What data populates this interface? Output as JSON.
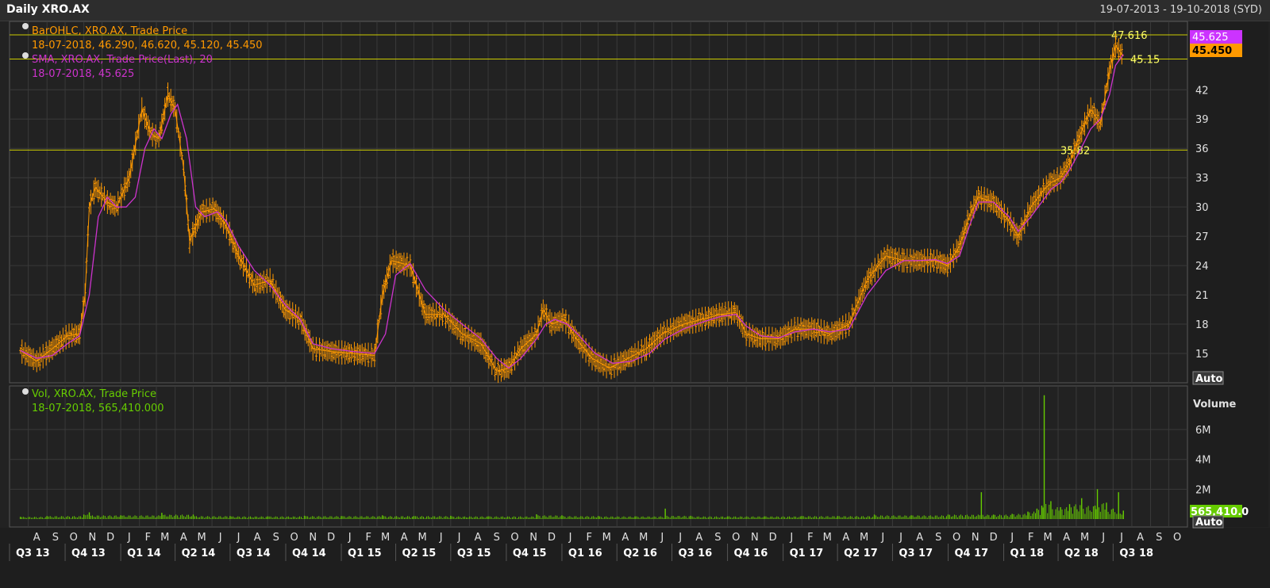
{
  "header": {
    "title": "Daily XRO.AX",
    "date_range": "19-07-2013 - 19-10-2018 (SYD)"
  },
  "colors": {
    "price": "#ff9900",
    "sma": "#cc33cc",
    "volume": "#66cc00",
    "hline": "#cccc00",
    "grid": "#3a3a3a",
    "axis_text": "#e0e0e0"
  },
  "price_panel": {
    "legend_ohlc_label": "BarOHLC, XRO.AX, Trade Price",
    "legend_ohlc_values": "18-07-2018, 46.290, 46.620, 45.120, 45.450",
    "legend_sma_label": "SMA, XRO.AX, Trade Price(Last),  20",
    "legend_sma_values": "18-07-2018, 45.625",
    "last_sma_badge": "45.625",
    "last_price_badge": "45.450",
    "auto_label": "Auto"
  },
  "volume_panel": {
    "legend_label": "Vol, XRO.AX, Trade Price",
    "legend_values": "18-07-2018, 565,410.000",
    "axis_title": "Volume",
    "last_volume_badge": "565,410.0",
    "auto_label": "Auto"
  },
  "chart_data": [
    {
      "type": "line",
      "subtype": "ohlc",
      "y_ticks": [
        15,
        18,
        21,
        24,
        27,
        30,
        33,
        36,
        39,
        42
      ],
      "ylim": [
        12,
        49
      ],
      "horizontal_lines": [
        {
          "value": 47.616,
          "label": "47.616"
        },
        {
          "value": 45.15,
          "label": "45.15"
        },
        {
          "value": 35.82,
          "label": "35.82"
        }
      ],
      "series": [
        {
          "name": "BarOHLC, XRO.AX, Trade Price",
          "x": [
            "2013-07-19",
            "2013-08-15",
            "2013-09-10",
            "2013-10-05",
            "2013-10-25",
            "2013-11-03",
            "2013-11-10",
            "2013-11-20",
            "2013-12-10",
            "2013-12-25",
            "2014-01-15",
            "2014-02-05",
            "2014-02-20",
            "2014-03-05",
            "2014-03-20",
            "2014-04-01",
            "2014-04-15",
            "2014-04-25",
            "2014-05-15",
            "2014-06-05",
            "2014-06-25",
            "2014-07-15",
            "2014-08-10",
            "2014-09-05",
            "2014-09-30",
            "2014-10-25",
            "2014-11-15",
            "2014-12-15",
            "2015-01-20",
            "2015-02-25",
            "2015-03-10",
            "2015-03-25",
            "2015-04-25",
            "2015-05-20",
            "2015-06-20",
            "2015-07-20",
            "2015-08-20",
            "2015-09-15",
            "2015-10-05",
            "2015-10-25",
            "2015-11-20",
            "2015-12-01",
            "2015-12-15",
            "2016-01-05",
            "2016-01-25",
            "2016-02-20",
            "2016-03-20",
            "2016-04-20",
            "2016-05-20",
            "2016-06-15",
            "2016-07-20",
            "2016-08-20",
            "2016-09-20",
            "2016-10-15",
            "2016-11-01",
            "2016-11-25",
            "2016-12-25",
            "2017-01-20",
            "2017-02-20",
            "2017-03-20",
            "2017-04-20",
            "2017-05-20",
            "2017-06-20",
            "2017-07-20",
            "2017-08-10",
            "2017-09-10",
            "2017-09-30",
            "2017-10-20",
            "2017-11-05",
            "2017-11-20",
            "2017-12-15",
            "2018-01-10",
            "2018-01-25",
            "2018-02-15",
            "2018-03-05",
            "2018-03-20",
            "2018-04-05",
            "2018-04-20",
            "2018-05-05",
            "2018-05-25",
            "2018-06-10",
            "2018-06-25",
            "2018-07-05",
            "2018-07-18"
          ],
          "values": [
            15.3,
            14.2,
            15.5,
            16.8,
            17.0,
            21.0,
            30.0,
            32.0,
            30.5,
            30.0,
            33.0,
            40.0,
            37.5,
            37.0,
            41.5,
            40.0,
            34.0,
            26.5,
            29.5,
            29.8,
            28.0,
            25.0,
            22.0,
            22.5,
            19.5,
            18.5,
            15.5,
            15.2,
            15.0,
            14.8,
            21.0,
            24.5,
            24.0,
            19.0,
            19.0,
            17.0,
            16.0,
            13.2,
            13.5,
            15.5,
            17.0,
            19.5,
            18.0,
            18.5,
            16.5,
            14.5,
            13.5,
            14.5,
            15.5,
            17.0,
            18.0,
            18.5,
            19.0,
            19.2,
            17.0,
            16.5,
            16.5,
            17.5,
            17.5,
            17.0,
            18.0,
            22.5,
            25.0,
            24.5,
            24.5,
            24.5,
            24.0,
            26.0,
            29.0,
            31.0,
            30.5,
            28.5,
            27.0,
            30.0,
            31.5,
            32.5,
            33.0,
            34.5,
            37.0,
            40.0,
            38.5,
            44.0,
            46.5,
            45.45
          ]
        },
        {
          "name": "SMA, XRO.AX, Trade Price(Last),  20",
          "x": [
            "2013-07-19",
            "2013-08-15",
            "2013-09-10",
            "2013-10-05",
            "2013-10-25",
            "2013-11-10",
            "2013-11-25",
            "2013-12-10",
            "2013-12-25",
            "2014-01-10",
            "2014-01-25",
            "2014-02-10",
            "2014-02-25",
            "2014-03-10",
            "2014-03-25",
            "2014-04-05",
            "2014-04-20",
            "2014-05-05",
            "2014-05-20",
            "2014-06-10",
            "2014-06-25",
            "2014-07-15",
            "2014-08-10",
            "2014-09-05",
            "2014-09-30",
            "2014-10-25",
            "2014-11-15",
            "2014-12-15",
            "2015-01-20",
            "2015-02-25",
            "2015-03-15",
            "2015-04-01",
            "2015-04-25",
            "2015-05-20",
            "2015-06-20",
            "2015-07-20",
            "2015-08-20",
            "2015-09-15",
            "2015-10-05",
            "2015-10-25",
            "2015-11-20",
            "2015-12-05",
            "2015-12-20",
            "2016-01-10",
            "2016-01-30",
            "2016-02-25",
            "2016-03-25",
            "2016-04-25",
            "2016-05-25",
            "2016-06-20",
            "2016-07-20",
            "2016-08-20",
            "2016-09-20",
            "2016-10-15",
            "2016-11-01",
            "2016-11-25",
            "2016-12-25",
            "2017-01-20",
            "2017-02-20",
            "2017-03-20",
            "2017-04-20",
            "2017-05-20",
            "2017-06-20",
            "2017-07-20",
            "2017-08-10",
            "2017-09-10",
            "2017-09-30",
            "2017-10-20",
            "2017-11-05",
            "2017-11-20",
            "2017-12-15",
            "2018-01-10",
            "2018-01-25",
            "2018-02-15",
            "2018-03-05",
            "2018-03-20",
            "2018-04-05",
            "2018-04-20",
            "2018-05-05",
            "2018-05-25",
            "2018-06-10",
            "2018-06-25",
            "2018-07-05",
            "2018-07-18"
          ],
          "values": [
            15.3,
            14.5,
            14.8,
            16.0,
            16.8,
            21.0,
            29.0,
            31.0,
            30.0,
            30.0,
            31.0,
            36.0,
            38.0,
            37.0,
            39.5,
            40.5,
            37.0,
            30.0,
            29.0,
            29.5,
            28.5,
            26.0,
            23.5,
            22.0,
            20.0,
            18.5,
            16.0,
            15.5,
            15.2,
            15.0,
            17.0,
            23.0,
            24.2,
            21.5,
            19.5,
            18.0,
            16.5,
            14.5,
            13.5,
            14.5,
            16.5,
            18.0,
            18.5,
            18.0,
            16.8,
            15.0,
            14.0,
            14.2,
            15.0,
            16.5,
            17.5,
            18.2,
            18.8,
            19.0,
            17.8,
            16.8,
            16.6,
            17.2,
            17.5,
            17.2,
            17.5,
            21.0,
            23.5,
            24.5,
            24.5,
            24.6,
            24.2,
            25.0,
            28.0,
            30.5,
            30.5,
            29.0,
            27.5,
            29.0,
            30.5,
            31.8,
            32.5,
            33.8,
            35.5,
            38.0,
            39.0,
            41.5,
            44.5,
            45.625
          ]
        }
      ]
    },
    {
      "type": "bar",
      "title": "Volume",
      "y_ticks": [
        2000000,
        4000000,
        6000000
      ],
      "y_tick_labels": [
        "2M",
        "4M",
        "6M"
      ],
      "ylim": [
        0,
        8500000
      ],
      "x": [
        "2013-07-19",
        "2013-09-01",
        "2013-11-01",
        "2013-11-10",
        "2014-01-01",
        "2014-03-10",
        "2014-05-01",
        "2014-07-01",
        "2014-09-01",
        "2014-11-01",
        "2015-01-01",
        "2015-03-10",
        "2015-05-01",
        "2015-07-01",
        "2015-09-01",
        "2015-11-20",
        "2016-01-01",
        "2016-03-01",
        "2016-05-01",
        "2016-06-20",
        "2016-08-01",
        "2016-10-01",
        "2016-12-01",
        "2017-02-01",
        "2017-04-01",
        "2017-06-01",
        "2017-08-01",
        "2017-10-01",
        "2017-11-25",
        "2017-12-15",
        "2018-01-15",
        "2018-02-10",
        "2018-02-25",
        "2018-03-05",
        "2018-03-09",
        "2018-03-20",
        "2018-04-05",
        "2018-04-20",
        "2018-05-10",
        "2018-06-01",
        "2018-06-05",
        "2018-06-20",
        "2018-07-01",
        "2018-07-10",
        "2018-07-18"
      ],
      "values": [
        150000,
        200000,
        300000,
        450000,
        250000,
        420000,
        300000,
        200000,
        180000,
        220000,
        200000,
        250000,
        200000,
        220000,
        180000,
        320000,
        250000,
        200000,
        180000,
        700000,
        220000,
        180000,
        180000,
        200000,
        200000,
        300000,
        250000,
        300000,
        1800000,
        300000,
        350000,
        500000,
        700000,
        900000,
        8300000,
        1200000,
        800000,
        1000000,
        1400000,
        900000,
        2000000,
        1100000,
        700000,
        1800000,
        565410
      ]
    }
  ],
  "x_axis": {
    "months": [
      "A",
      "S",
      "O",
      "N",
      "D",
      "J",
      "F",
      "M",
      "A",
      "M",
      "J",
      "J",
      "A",
      "S",
      "O",
      "N",
      "D",
      "J",
      "F",
      "M",
      "A",
      "M",
      "J",
      "J",
      "A",
      "S",
      "O",
      "N",
      "D",
      "J",
      "F",
      "M",
      "A",
      "M",
      "J",
      "J",
      "A",
      "S",
      "O",
      "N",
      "D",
      "J",
      "F",
      "M",
      "A",
      "M",
      "J",
      "J",
      "A",
      "S",
      "O",
      "N",
      "D",
      "J",
      "F",
      "M",
      "A",
      "M",
      "J",
      "J",
      "A",
      "S",
      "O"
    ],
    "quarters": [
      "Q3 13",
      "Q4 13",
      "Q1 14",
      "Q2 14",
      "Q3 14",
      "Q4 14",
      "Q1 15",
      "Q2 15",
      "Q3 15",
      "Q4 15",
      "Q1 16",
      "Q2 16",
      "Q3 16",
      "Q4 16",
      "Q1 17",
      "Q2 17",
      "Q3 17",
      "Q4 17",
      "Q1 18",
      "Q2 18",
      "Q3 18"
    ]
  }
}
